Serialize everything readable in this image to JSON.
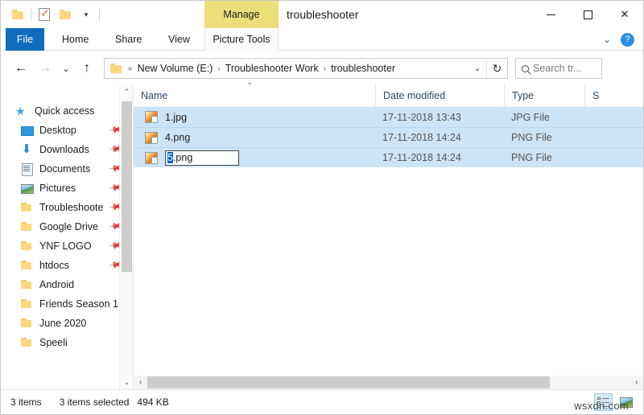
{
  "window": {
    "title": "troubleshooter",
    "minimize_label": "Minimize",
    "maximize_label": "Maximize",
    "close_label": "Close"
  },
  "quick_access_toolbar": {
    "items": [
      {
        "name": "folder-icon",
        "label": ""
      },
      {
        "name": "properties-icon",
        "label": ""
      },
      {
        "name": "new-folder-icon",
        "label": ""
      },
      {
        "name": "customize-dropdown-icon",
        "label": "▾"
      }
    ]
  },
  "ribbon": {
    "context_banner": "Manage",
    "tabs": [
      {
        "label": "File",
        "active": true
      },
      {
        "label": "Home",
        "active": false
      },
      {
        "label": "Share",
        "active": false
      },
      {
        "label": "View",
        "active": false
      },
      {
        "label": "Picture Tools",
        "active": false
      }
    ],
    "collapse_label": "⌄",
    "help_label": "?"
  },
  "addressbar": {
    "back_label": "←",
    "forward_label": "→",
    "recent_label": "⌄",
    "up_label": "↑",
    "overflow_label": "«",
    "crumbs": [
      "New Volume (E:)",
      "Troubleshooter Work",
      "troubleshooter"
    ],
    "separator": "›",
    "dropdown_label": "⌄",
    "refresh_label": "↻",
    "search_placeholder": "Search tr..."
  },
  "navpane": {
    "items": [
      {
        "label": "Quick access",
        "icon": "star-icon",
        "pinned": false,
        "root": true
      },
      {
        "label": "Desktop",
        "icon": "desktop-icon",
        "pinned": true,
        "root": false
      },
      {
        "label": "Downloads",
        "icon": "downloads-icon",
        "pinned": true,
        "root": false
      },
      {
        "label": "Documents",
        "icon": "documents-icon",
        "pinned": true,
        "root": false
      },
      {
        "label": "Pictures",
        "icon": "pictures-icon",
        "pinned": true,
        "root": false
      },
      {
        "label": "Troubleshoote",
        "icon": "folder-icon",
        "pinned": true,
        "root": false
      },
      {
        "label": "Google Drive",
        "icon": "folder-icon",
        "pinned": true,
        "root": false
      },
      {
        "label": "YNF LOGO",
        "icon": "folder-icon",
        "pinned": true,
        "root": false
      },
      {
        "label": "htdocs",
        "icon": "folder-icon",
        "pinned": true,
        "root": false
      },
      {
        "label": "Android",
        "icon": "folder-icon",
        "pinned": false,
        "root": false
      },
      {
        "label": "Friends Season 1",
        "icon": "folder-icon",
        "pinned": false,
        "root": false
      },
      {
        "label": "June 2020",
        "icon": "folder-icon",
        "pinned": false,
        "root": false
      },
      {
        "label": "Speeli",
        "icon": "folder-icon",
        "pinned": false,
        "root": false
      }
    ],
    "scroll_up_label": "⌃",
    "scroll_down_label": "⌄"
  },
  "filelist": {
    "columns": [
      {
        "label": "Name",
        "sorted": true,
        "sort_caret": "⌃"
      },
      {
        "label": "Date modified",
        "sorted": false
      },
      {
        "label": "Type",
        "sorted": false
      },
      {
        "label": "S",
        "sorted": false
      }
    ],
    "rows": [
      {
        "name": "1.jpg",
        "date": "17-11-2018 13:43",
        "type": "JPG File",
        "size": "",
        "selected": true,
        "renaming": false
      },
      {
        "name": "4.png",
        "date": "17-11-2018 14:24",
        "type": "PNG File",
        "size": "",
        "selected": true,
        "renaming": false
      },
      {
        "name": "5.png",
        "date": "17-11-2018 14:24",
        "type": "PNG File",
        "size": "",
        "selected": true,
        "renaming": true
      }
    ],
    "rename": {
      "selected_part": "5",
      "rest_part": ".png"
    },
    "hscroll_left_label": "‹",
    "hscroll_right_label": "›"
  },
  "statusbar": {
    "item_count": "3 items",
    "selection": "3 items selected",
    "size": "494 KB",
    "details_view_label": "Details view",
    "thumbnail_view_label": "Large icons view"
  },
  "watermark": "wsxdn.com",
  "colors": {
    "file_tab_blue": "#0f6cbd",
    "context_banner_yellow": "#ecdf7a",
    "selection_blue": "#cce4f7",
    "rename_select_blue": "#0a64c2",
    "help_blue": "#2b8fe0",
    "folder_yellow": "#fcd77e"
  }
}
